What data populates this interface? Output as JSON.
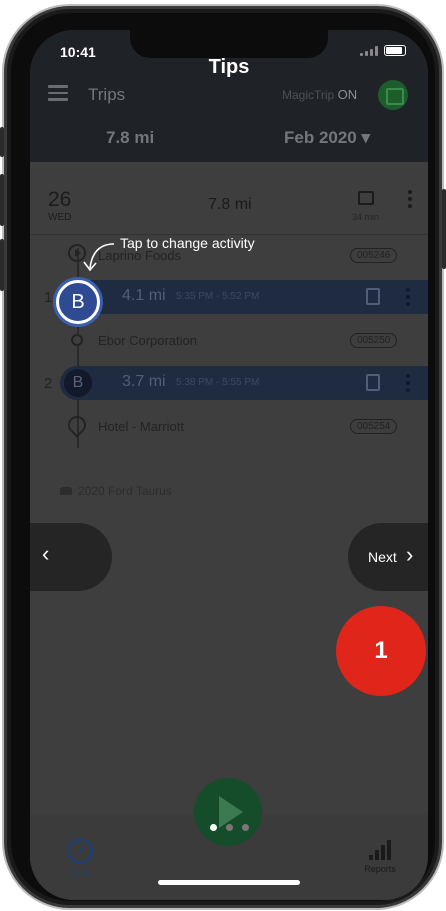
{
  "status": {
    "time": "10:41"
  },
  "header": {
    "title": "Tips",
    "nav_label": "Trips",
    "magictrip_label": "MagicTrip",
    "magictrip_state": "ON",
    "summary_distance": "7.8 mi",
    "summary_period": "Feb 2020 ▾"
  },
  "day": {
    "date_num": "26",
    "weekday": "WED",
    "distance": "7.8 mi",
    "duration": "34 min"
  },
  "stops": [
    {
      "name": "Laprino Foods",
      "code": "005246"
    },
    {
      "name": "Ebor Corporation",
      "code": "005250"
    },
    {
      "name": "Hotel - Marriott",
      "code": "005254"
    }
  ],
  "trips": [
    {
      "index": "1",
      "activity": "B",
      "distance": "4.1 mi",
      "time": "5:35 PM - 5:52 PM"
    },
    {
      "index": "2",
      "activity": "B",
      "distance": "3.7 mi",
      "time": "5:38 PM - 5:55 PM"
    }
  ],
  "vehicle": "2020 Ford Taurus",
  "tip": {
    "text": "Tap to change activity",
    "next_label": "Next",
    "step_number": "1",
    "page_count": 3,
    "current_page": 1
  },
  "tabbar": {
    "trips_label": "Trips",
    "reports_label": "Reports"
  },
  "colors": {
    "accent_blue": "#2d4a92",
    "step_red": "#e0261b",
    "fab_green": "#154d2b"
  }
}
